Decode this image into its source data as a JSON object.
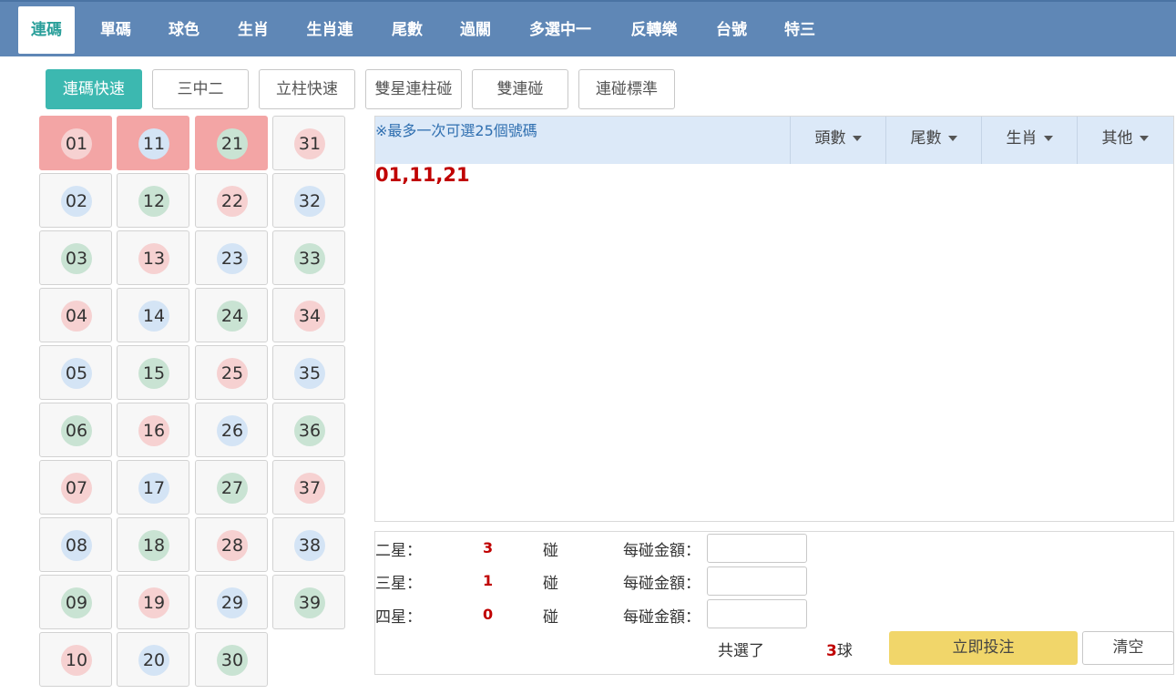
{
  "nav": {
    "tabs": [
      "連碼",
      "單碼",
      "球色",
      "生肖",
      "生肖連",
      "尾數",
      "過關",
      "多選中一",
      "反轉樂",
      "台號",
      "特三"
    ],
    "active_index": 0
  },
  "subtabs": {
    "items": [
      "連碼快速",
      "三中二",
      "立柱快速",
      "雙星連柱碰",
      "雙連碰",
      "連碰標準"
    ],
    "active_index": 0
  },
  "numbers": [
    {
      "label": "01",
      "color": "red",
      "selected": true
    },
    {
      "label": "02",
      "color": "blue",
      "selected": false
    },
    {
      "label": "03",
      "color": "green",
      "selected": false
    },
    {
      "label": "04",
      "color": "red",
      "selected": false
    },
    {
      "label": "05",
      "color": "blue",
      "selected": false
    },
    {
      "label": "06",
      "color": "green",
      "selected": false
    },
    {
      "label": "07",
      "color": "red",
      "selected": false
    },
    {
      "label": "08",
      "color": "blue",
      "selected": false
    },
    {
      "label": "09",
      "color": "green",
      "selected": false
    },
    {
      "label": "10",
      "color": "red",
      "selected": false
    },
    {
      "label": "11",
      "color": "blue",
      "selected": true
    },
    {
      "label": "12",
      "color": "green",
      "selected": false
    },
    {
      "label": "13",
      "color": "red",
      "selected": false
    },
    {
      "label": "14",
      "color": "blue",
      "selected": false
    },
    {
      "label": "15",
      "color": "green",
      "selected": false
    },
    {
      "label": "16",
      "color": "red",
      "selected": false
    },
    {
      "label": "17",
      "color": "blue",
      "selected": false
    },
    {
      "label": "18",
      "color": "green",
      "selected": false
    },
    {
      "label": "19",
      "color": "red",
      "selected": false
    },
    {
      "label": "20",
      "color": "blue",
      "selected": false
    },
    {
      "label": "21",
      "color": "green",
      "selected": true
    },
    {
      "label": "22",
      "color": "red",
      "selected": false
    },
    {
      "label": "23",
      "color": "blue",
      "selected": false
    },
    {
      "label": "24",
      "color": "green",
      "selected": false
    },
    {
      "label": "25",
      "color": "red",
      "selected": false
    },
    {
      "label": "26",
      "color": "blue",
      "selected": false
    },
    {
      "label": "27",
      "color": "green",
      "selected": false
    },
    {
      "label": "28",
      "color": "red",
      "selected": false
    },
    {
      "label": "29",
      "color": "blue",
      "selected": false
    },
    {
      "label": "30",
      "color": "green",
      "selected": false
    },
    {
      "label": "31",
      "color": "red",
      "selected": false
    },
    {
      "label": "32",
      "color": "blue",
      "selected": false
    },
    {
      "label": "33",
      "color": "green",
      "selected": false
    },
    {
      "label": "34",
      "color": "red",
      "selected": false
    },
    {
      "label": "35",
      "color": "blue",
      "selected": false
    },
    {
      "label": "36",
      "color": "green",
      "selected": false
    },
    {
      "label": "37",
      "color": "red",
      "selected": false
    },
    {
      "label": "38",
      "color": "blue",
      "selected": false
    },
    {
      "label": "39",
      "color": "green",
      "selected": false
    }
  ],
  "panel": {
    "hint": "※最多一次可選25個號碼",
    "dropdowns": [
      "頭數",
      "尾數",
      "生肖",
      "其他"
    ],
    "selected_text": "01,11,21"
  },
  "bet": {
    "rows": [
      {
        "label": "二星：",
        "count": "3",
        "unit": "碰",
        "amount_label": "每碰金額：",
        "amount": ""
      },
      {
        "label": "三星：",
        "count": "1",
        "unit": "碰",
        "amount_label": "每碰金額：",
        "amount": ""
      },
      {
        "label": "四星：",
        "count": "0",
        "unit": "碰",
        "amount_label": "每碰金額：",
        "amount": ""
      }
    ],
    "total_prefix": "共選了",
    "total_count": "3",
    "total_suffix": "球",
    "submit_label": "立即投注",
    "clear_label": "清空"
  },
  "colors": {
    "nav_bg": "#5f87b6",
    "accent": "#3cb8b0",
    "selected_cell": "#f3a5a5",
    "ball_red": "#f6d1d1",
    "ball_blue": "#d4e4f5",
    "ball_green": "#c9e3d3",
    "highlight_text": "#c00000",
    "submit_bg": "#f1d66a"
  }
}
